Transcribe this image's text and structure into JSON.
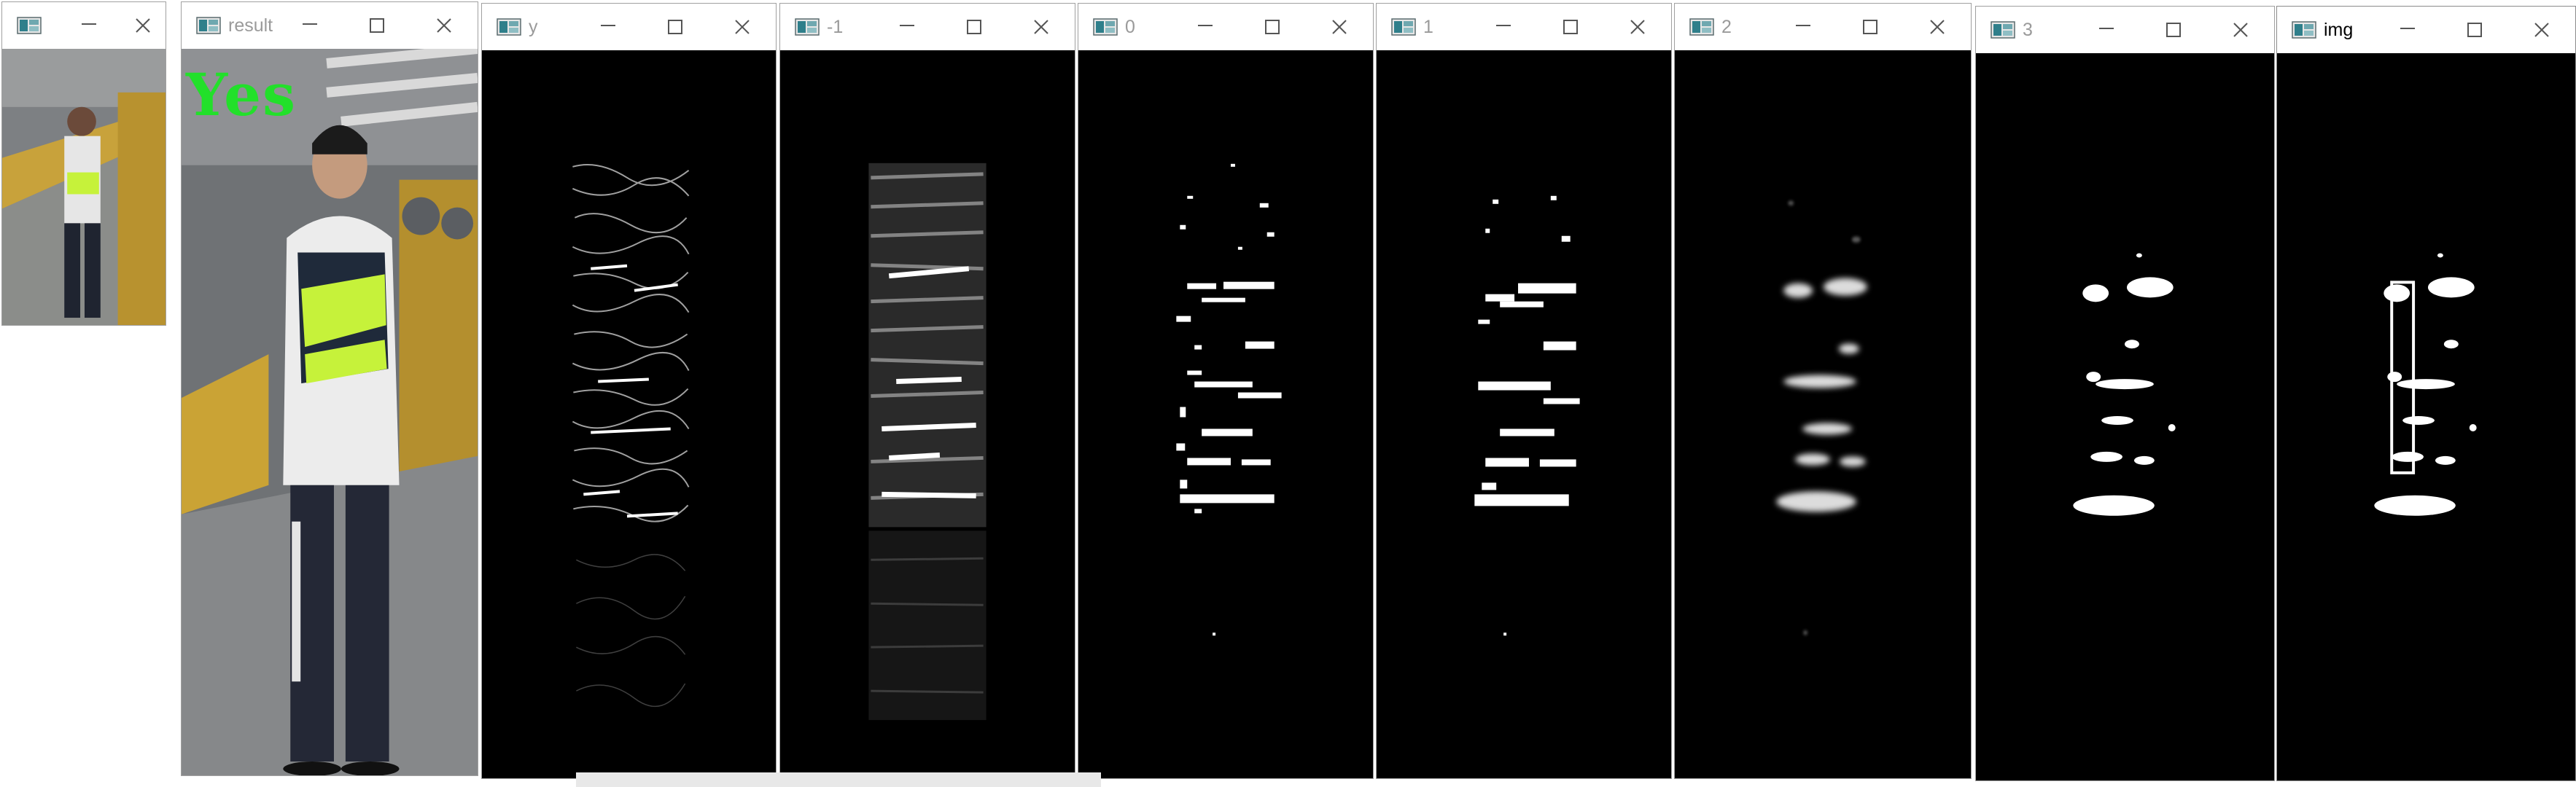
{
  "windows": [
    {
      "id": "small",
      "title": ""
    },
    {
      "id": "result",
      "title": "result",
      "overlay": "Yes"
    },
    {
      "id": "y",
      "title": "y"
    },
    {
      "id": "neg1",
      "title": "-1"
    },
    {
      "id": "zero",
      "title": "0"
    },
    {
      "id": "one",
      "title": "1"
    },
    {
      "id": "two",
      "title": "2"
    },
    {
      "id": "three",
      "title": "3"
    },
    {
      "id": "img",
      "title": "img"
    }
  ],
  "icons": {
    "app": "opencv-window-icon",
    "minimize": "minimize-icon",
    "maximize": "maximize-icon",
    "close": "close-icon"
  },
  "colors": {
    "overlay_text": "#22e02a",
    "vest": "#c6f23a",
    "background": "#000000"
  }
}
